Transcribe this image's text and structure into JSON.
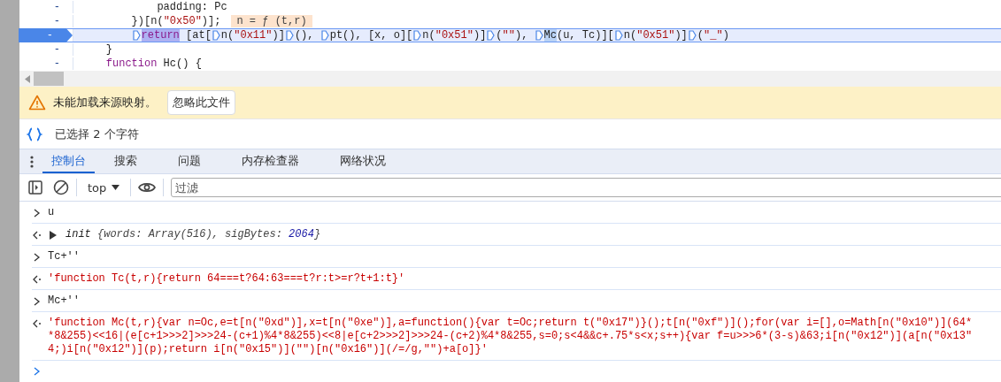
{
  "editor": {
    "lines": [
      {
        "number": "-",
        "current": false,
        "segments": [
          {
            "kind": "plain",
            "text": "            padding: Pc"
          }
        ]
      },
      {
        "number": "-",
        "current": false,
        "segments": [
          {
            "kind": "plain",
            "text": "        })[n("
          },
          {
            "kind": "string",
            "text": "\"0x50\""
          },
          {
            "kind": "plain",
            "text": ")];"
          }
        ],
        "inline_value": "n = ƒ (t,r)"
      },
      {
        "number": "-",
        "current": true,
        "segments": [
          {
            "kind": "marker"
          },
          {
            "kind": "keyword",
            "text": "return",
            "highlighted": true
          },
          {
            "kind": "plain",
            "text": " [at["
          },
          {
            "kind": "marker"
          },
          {
            "kind": "plain",
            "text": "n("
          },
          {
            "kind": "string",
            "text": "\"0x11\""
          },
          {
            "kind": "plain",
            "text": ")]"
          },
          {
            "kind": "marker"
          },
          {
            "kind": "plain",
            "text": "(), "
          },
          {
            "kind": "marker"
          },
          {
            "kind": "plain",
            "text": "pt(), [x, o]["
          },
          {
            "kind": "marker"
          },
          {
            "kind": "plain",
            "text": "n("
          },
          {
            "kind": "string",
            "text": "\"0x51\""
          },
          {
            "kind": "plain",
            "text": ")]"
          },
          {
            "kind": "marker"
          },
          {
            "kind": "plain",
            "text": "("
          },
          {
            "kind": "string",
            "text": "\"\""
          },
          {
            "kind": "plain",
            "text": "), "
          },
          {
            "kind": "marker"
          },
          {
            "kind": "plain",
            "text": "Mc",
            "highlighted": true
          },
          {
            "kind": "plain",
            "text": "(u, Tc)]["
          },
          {
            "kind": "marker"
          },
          {
            "kind": "plain",
            "text": "n("
          },
          {
            "kind": "string",
            "text": "\"0x51\""
          },
          {
            "kind": "plain",
            "text": ")]"
          },
          {
            "kind": "marker"
          },
          {
            "kind": "plain",
            "text": "("
          },
          {
            "kind": "string",
            "text": "\"_\""
          },
          {
            "kind": "plain",
            "text": ")"
          }
        ]
      },
      {
        "number": "-",
        "current": false,
        "segments": [
          {
            "kind": "plain",
            "text": "    }"
          }
        ]
      },
      {
        "number": "-",
        "current": false,
        "segments": [
          {
            "kind": "keyword",
            "text": "    function"
          },
          {
            "kind": "plain",
            "text": " Hc() {"
          }
        ]
      }
    ]
  },
  "warning": {
    "message": "未能加载来源映射。",
    "button": "忽略此文件"
  },
  "status": {
    "text": "已选择 2 个字符"
  },
  "tabs": [
    {
      "label": "控制台",
      "selected": true
    },
    {
      "label": "搜索",
      "selected": false
    },
    {
      "label": "问题",
      "selected": false
    },
    {
      "label": "内存检查器",
      "selected": false
    },
    {
      "label": "网络状况",
      "selected": false
    }
  ],
  "toolbar": {
    "context": "top",
    "filter": {
      "placeholder": "过滤"
    }
  },
  "console": [
    {
      "kind": "input",
      "lines": [
        "u"
      ]
    },
    {
      "kind": "object",
      "expanded": false,
      "segments": [
        {
          "kind": "name",
          "text": "init "
        },
        {
          "kind": "prop",
          "text": "{words: Array(516), sigBytes: "
        },
        {
          "kind": "number",
          "text": "2064"
        },
        {
          "kind": "prop",
          "text": "}"
        }
      ]
    },
    {
      "kind": "input",
      "lines": [
        "Tc+''"
      ]
    },
    {
      "kind": "string",
      "lines": [
        "'function Tc(t,r){return 64===t?64:63===t?r:t>=r?t+1:t}'"
      ]
    },
    {
      "kind": "input",
      "lines": [
        "Mc+''"
      ]
    },
    {
      "kind": "string",
      "lines": [
        "'function Mc(t,r){var n=Oc,e=t[n(\"0xd\")],x=t[n(\"0xe\")],a=function(){var t=Oc;return t(\"0x17\")}();t[n(\"0xf\")]();for(var i=[],o=Math[n(\"0x10\")](64*",
        "*8&255)<<16|(e[c+1>>>2]>>>24-(c+1)%4*8&255)<<8|e[c+2>>>2]>>>24-(c+2)%4*8&255,s=0;s<4&&c+.75*s<x;s++){var f=u>>>6*(3-s)&63;i[n(\"0x12\")](a[n(\"0x13\"",
        "4;)i[n(\"0x12\")](p);return i[n(\"0x15\")](\"\")[n(\"0x16\")](/=/g,\"\")+a[o]}'"
      ]
    }
  ]
}
